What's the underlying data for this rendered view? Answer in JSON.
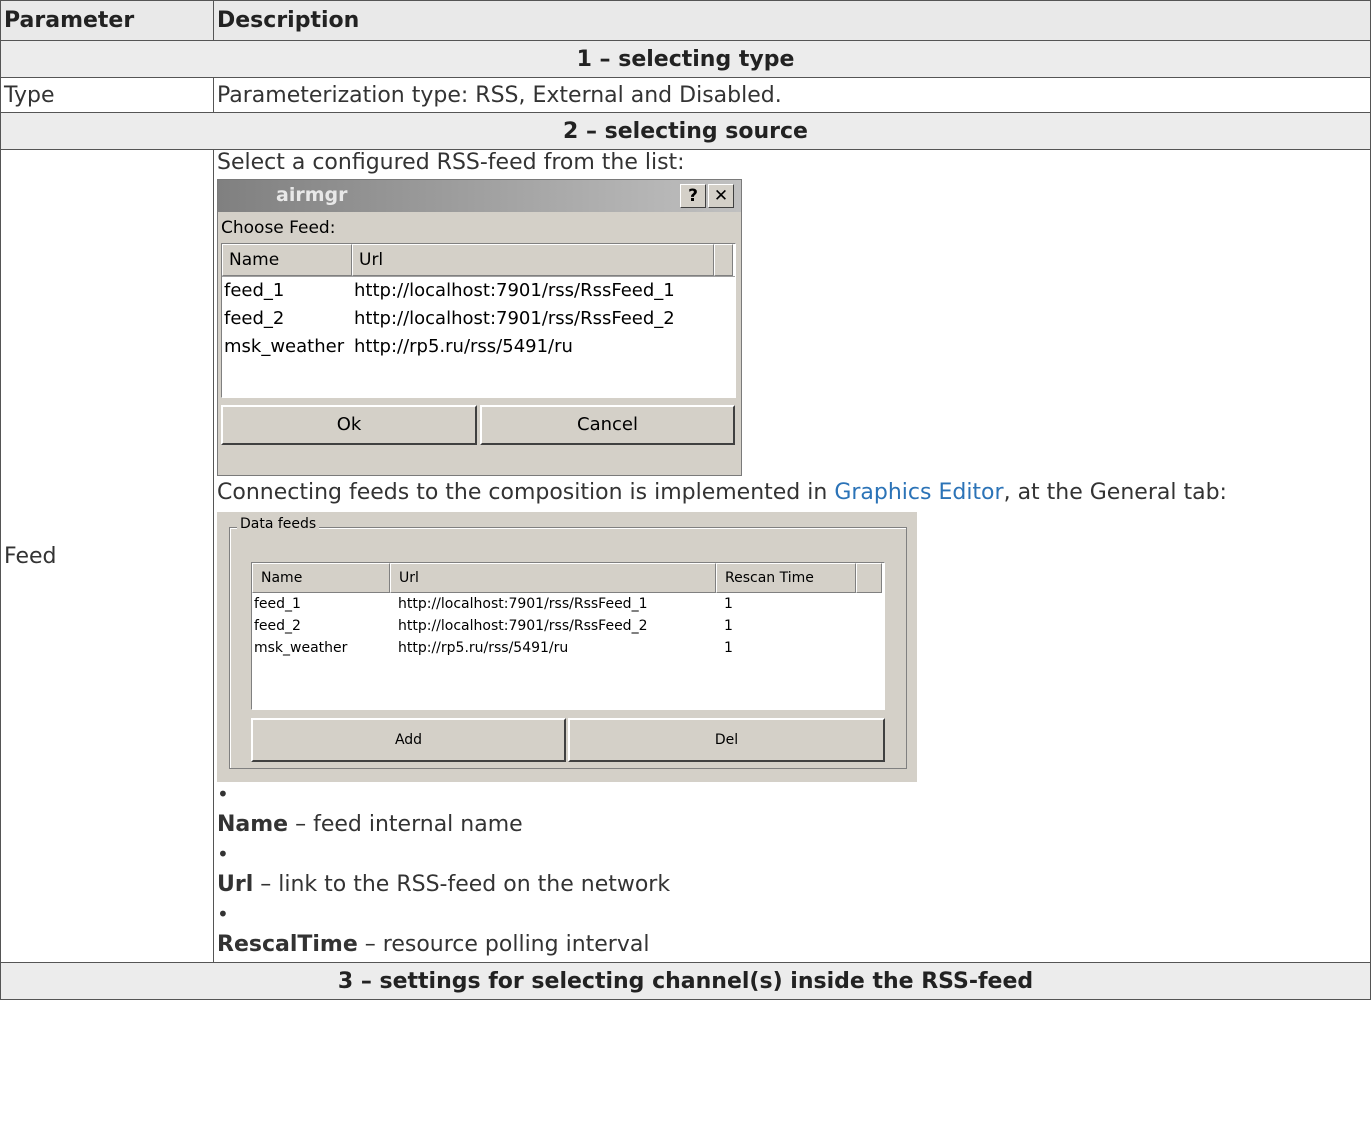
{
  "table": {
    "header": {
      "parameter": "Parameter",
      "description": "Description"
    },
    "section1": "1 – selecting type",
    "type_row": {
      "param": "Type",
      "desc": "Parameterization type: RSS, External and Disabled."
    },
    "section2": "2 – selecting source",
    "feed_row": {
      "param": "Feed",
      "intro": "Select a configured RSS-feed from the list:",
      "connecting_before": "Connecting feeds to the composition is implemented in ",
      "connecting_link": "Graphics Editor",
      "connecting_after": ", at the General tab:",
      "bullet_glyph": "•",
      "bullets": [
        {
          "term": "Name",
          "text": " – feed internal name"
        },
        {
          "term": "Url",
          "text": " – link to the RSS-feed on the network"
        },
        {
          "term": "RescalTime",
          "text": " – resource polling interval"
        }
      ]
    },
    "section3": "3 – settings for selecting channel(s) inside the RSS-feed"
  },
  "choose_dialog": {
    "title": "airmgr",
    "help_glyph": "?",
    "close_glyph": "✕",
    "label": "Choose Feed:",
    "columns": [
      "Name",
      "Url"
    ],
    "rows": [
      [
        "feed_1",
        "http://localhost:7901/rss/RssFeed_1"
      ],
      [
        "feed_2",
        "http://localhost:7901/rss/RssFeed_2"
      ],
      [
        "msk_weather",
        "http://rp5.ru/rss/5491/ru"
      ]
    ],
    "ok": "Ok",
    "cancel": "Cancel"
  },
  "data_feeds_panel": {
    "legend": "Data feeds",
    "columns": [
      "Name",
      "Url",
      "Rescan Time"
    ],
    "rows": [
      [
        "feed_1",
        "http://localhost:7901/rss/RssFeed_1",
        "1"
      ],
      [
        "feed_2",
        "http://localhost:7901/rss/RssFeed_2",
        "1"
      ],
      [
        "msk_weather",
        "http://rp5.ru/rss/5491/ru",
        "1"
      ]
    ],
    "add": "Add",
    "del": "Del"
  }
}
